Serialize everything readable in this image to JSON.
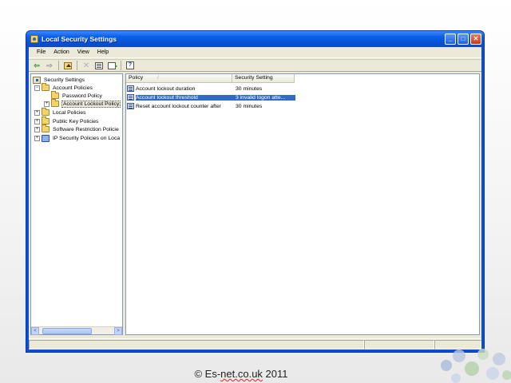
{
  "window": {
    "title": "Local Security Settings",
    "controls": {
      "minimize": "_",
      "maximize": "□",
      "close": "✕"
    }
  },
  "menu": [
    "File",
    "Action",
    "View",
    "Help"
  ],
  "toolbar": {
    "icons": [
      "back-arrow-icon",
      "forward-arrow-icon",
      "up-folder-icon",
      "delete-icon",
      "properties-icon",
      "export-list-icon",
      "help-icon"
    ]
  },
  "tree": {
    "root": "Security Settings",
    "items": [
      {
        "label": "Account Policies",
        "expander": "−",
        "level": 1
      },
      {
        "label": "Password Policy",
        "expander": "",
        "level": 2
      },
      {
        "label": "Account Lockout Policy",
        "expander": "+",
        "level": 2,
        "selected": true
      },
      {
        "label": "Local Policies",
        "expander": "+",
        "level": 1
      },
      {
        "label": "Public Key Policies",
        "expander": "+",
        "level": 1
      },
      {
        "label": "Software Restriction Policie",
        "expander": "+",
        "level": 1
      },
      {
        "label": "IP Security Policies on Loca",
        "expander": "+",
        "level": 1
      }
    ]
  },
  "list": {
    "columns": [
      "Policy",
      "Security Setting"
    ],
    "sort_glyph": "/",
    "rows": [
      {
        "policy": "Account lockout duration",
        "setting": "30 minutes",
        "selected": false
      },
      {
        "policy": "Account lockout threshold",
        "setting": "3 invalid logon atte...",
        "selected": true
      },
      {
        "policy": "Reset account lockout counter after",
        "setting": "30 minutes",
        "selected": false
      }
    ]
  },
  "footer": {
    "prefix": "© Es-",
    "underlined": "net.co.uk",
    "suffix": " 2011"
  },
  "colors": {
    "titlebar": "#0b5fe8",
    "selection": "#316ac5",
    "chrome": "#ece9d8"
  }
}
